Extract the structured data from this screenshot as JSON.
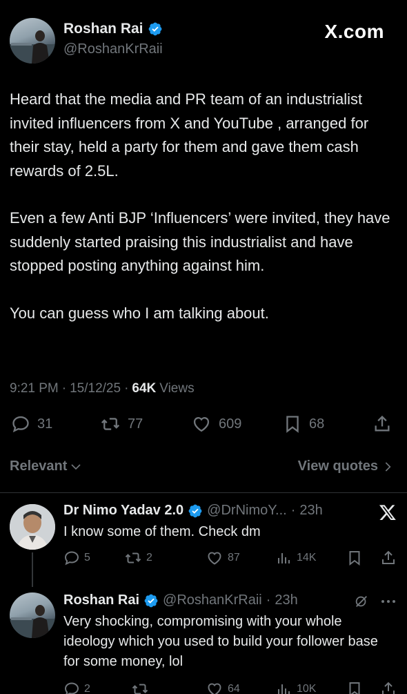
{
  "main_tweet": {
    "author_name": "Roshan Rai",
    "author_handle": "@RoshanKrRaii",
    "site_label": "X.com",
    "paragraphs": [
      "Heard that the media and PR team of an industrialist invited influencers from X and YouTube , arranged for their stay, held a party for them and gave them cash rewards of 2.5L.",
      "Even a few Anti BJP ‘Influencers’ were invited, they have suddenly started praising this industrialist and have stopped posting anything against him.",
      "You can guess who I am talking about."
    ],
    "time": "9:21 PM",
    "date": "15/12/25",
    "views_count": "64K",
    "views_label": "Views",
    "replies": "31",
    "reposts": "77",
    "likes": "609",
    "bookmarks": "68"
  },
  "filter": {
    "sort_label": "Relevant",
    "quotes_label": "View quotes"
  },
  "replies": [
    {
      "author_name": "Dr Nimo Yadav 2.0",
      "author_handle": "@DrNimoY...",
      "time": "23h",
      "text": "I know some of them. Check dm",
      "replies": "5",
      "reposts": "2",
      "likes": "87",
      "views": "14K"
    },
    {
      "author_name": "Roshan Rai",
      "author_handle": "@RoshanKrRaii",
      "time": "23h",
      "text": "Very shocking, compromising with your whole ideology which you used to build your follower base for some money, lol",
      "replies": "2",
      "reposts": "",
      "likes": "64",
      "views": "10K"
    }
  ],
  "colors": {
    "background": "#000000",
    "text": "#e7e9ea",
    "muted": "#71767b",
    "verified": "#1d9bf0",
    "divider": "#2f3336"
  }
}
